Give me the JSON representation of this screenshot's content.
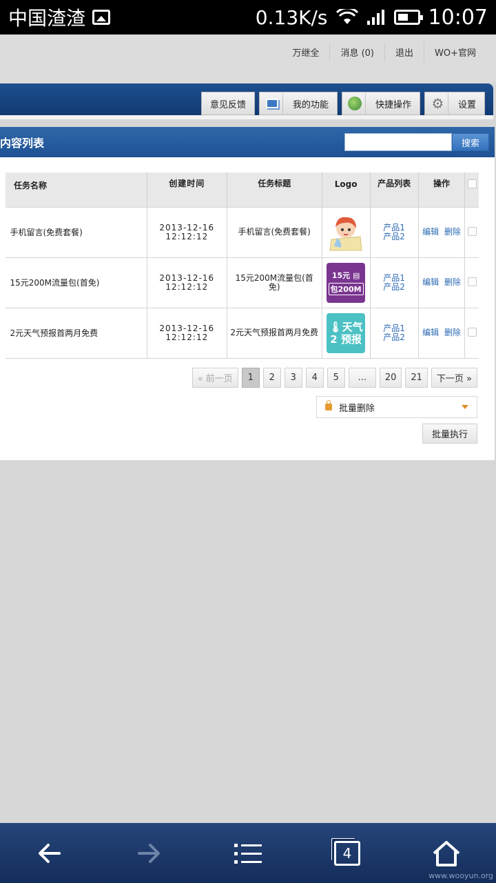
{
  "status_bar": {
    "carrier": "中国渣渣",
    "speed": "0.13K/s",
    "time": "10:07"
  },
  "top_links": [
    "万继全",
    "消息 (0)",
    "退出",
    "WO+官网"
  ],
  "nav_buttons": {
    "feedback": "意见反馈",
    "my_functions": "我的功能",
    "quick_actions": "快捷操作",
    "settings": "设置"
  },
  "panel": {
    "title": "内容列表",
    "search_button": "搜索",
    "search_value": ""
  },
  "table": {
    "headers": {
      "name": "任务名称",
      "time": "创建时间",
      "title": "任务标题",
      "logo": "Logo",
      "products": "产品列表",
      "ops": "操作"
    },
    "rows": [
      {
        "name": "手机留言(免费套餐)",
        "date": "2013-12-16",
        "clock": "12:12:12",
        "title": "手机留言(免费套餐)",
        "logo": "girl-logo",
        "p1": "产品1",
        "p2": "产品2",
        "edit": "编辑",
        "del": "删除"
      },
      {
        "name": "15元200M流量包(首免)",
        "date": "2013-12-16",
        "clock": "12:12:12",
        "title": "15元200M流量包(首免)",
        "logo": "15元 包200M",
        "p1": "产品1",
        "p2": "产品2",
        "edit": "编辑",
        "del": "删除"
      },
      {
        "name": "2元天气预报首两月免费",
        "date": "2013-12-16",
        "clock": "12:12:12",
        "title": "2元天气预报首两月免费",
        "logo": "2元 天气 预报",
        "p1": "产品1",
        "p2": "产品2",
        "edit": "编辑",
        "del": "删除"
      }
    ]
  },
  "pagination": {
    "prev": "« 前一页",
    "pages": [
      "1",
      "2",
      "3",
      "4",
      "5",
      "...",
      "20",
      "21"
    ],
    "current": "1",
    "next": "下一页 »"
  },
  "batch": {
    "select_value": "批量删除",
    "run_label": "批量执行"
  },
  "bottom_bar": {
    "tab_count": "4"
  },
  "watermark": "www.wooyun.org"
}
